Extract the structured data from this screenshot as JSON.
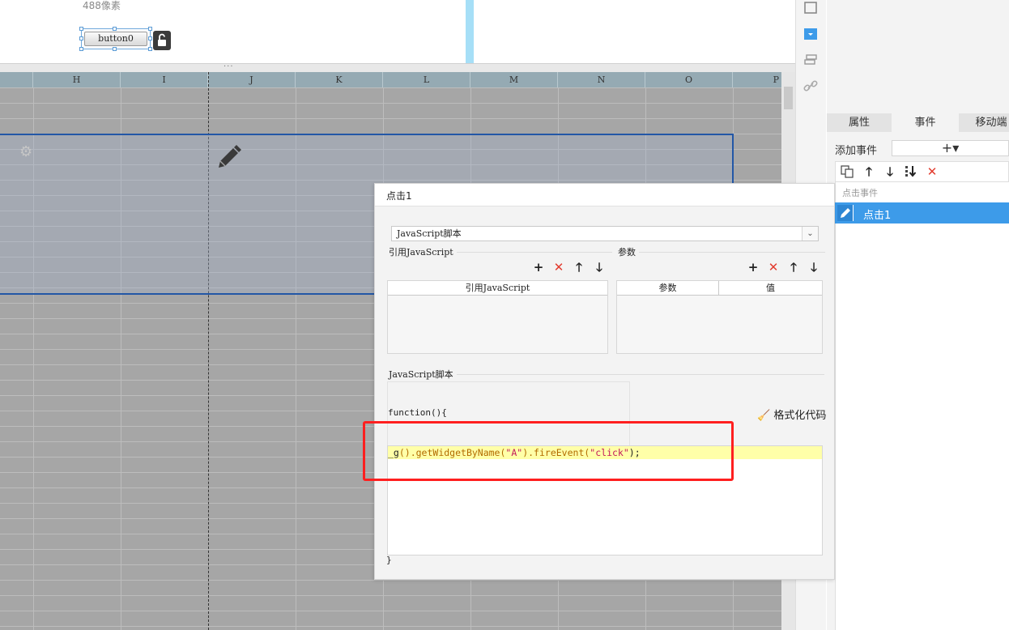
{
  "canvas": {
    "size_label": "488像素",
    "widget_label": "button0",
    "divider_dots": "···"
  },
  "sheet": {
    "columns": [
      "H",
      "I",
      "J",
      "K",
      "L",
      "M",
      "N",
      "O",
      "P"
    ]
  },
  "panel": {
    "tabs": [
      "属性",
      "事件",
      "移动端"
    ],
    "add_event_label": "添加事件",
    "add_event_symbol": "+▾",
    "event_category": "点击事件",
    "event_item": "点击1"
  },
  "dialog": {
    "title": "点击1",
    "type_select": "JavaScript脚本",
    "ref_js_section": "引用JavaScript",
    "params_section": "参数",
    "ref_js_col": "引用JavaScript",
    "params_cols": [
      "参数",
      "值"
    ],
    "js_section": "JavaScript脚本",
    "fn_open": "function(){",
    "format_label": "格式化代码",
    "code": {
      "part1": "_g",
      "part2": "().getWidgetByName(",
      "str1": "\"A\"",
      "part3": ").fireEvent(",
      "str2": "\"click\"",
      "part4": ");"
    },
    "fn_close": "}"
  },
  "colors": {
    "selection_border": "#2357a6",
    "active_event": "#3d9be9",
    "highlight_box": "#ff1f1f",
    "delete_red": "#e23b2e"
  }
}
